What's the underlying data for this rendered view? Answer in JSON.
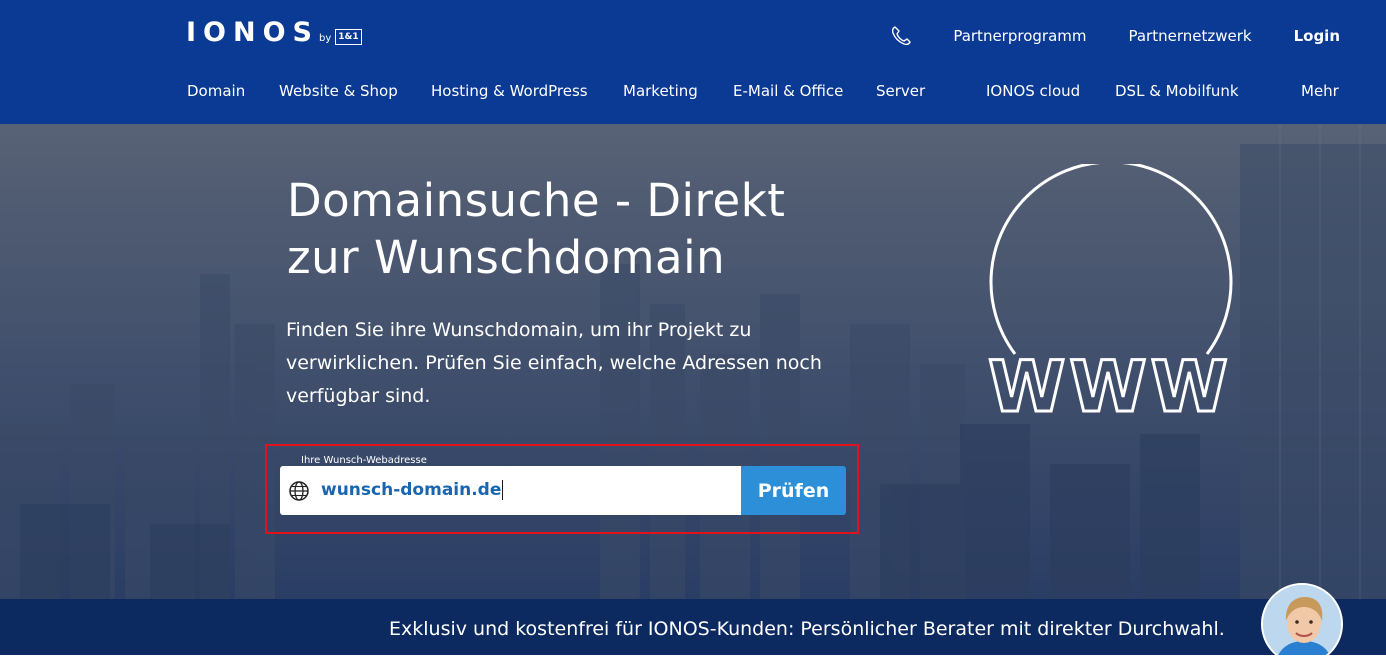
{
  "header": {
    "logo": {
      "wordmark": "IONOS",
      "by": "by",
      "badge": "1&1"
    },
    "top_links": [
      {
        "label": "Partnerprogramm"
      },
      {
        "label": "Partnernetzwerk"
      },
      {
        "label": "Login"
      }
    ],
    "nav": [
      {
        "label": "Domain"
      },
      {
        "label": "Website & Shop"
      },
      {
        "label": "Hosting & WordPress"
      },
      {
        "label": "Marketing"
      },
      {
        "label": "E-Mail & Office"
      },
      {
        "label": "Server"
      },
      {
        "label": "IONOS cloud"
      },
      {
        "label": "DSL & Mobilfunk"
      },
      {
        "label": "Mehr"
      }
    ]
  },
  "hero": {
    "title_line1": "Domainsuche - Direkt",
    "title_line2": "zur Wunschdomain",
    "subtitle": "Finden Sie ihre Wunschdomain, um ihr Projekt zu verwirklichen. Prüfen Sie einfach, welche Adressen noch verfügbar sind.",
    "search": {
      "label": "Ihre Wunsch-Webadresse",
      "value": "wunsch-domain.de",
      "button_label": "Prüfen"
    },
    "graphic_text": "WWW"
  },
  "banner": {
    "text": "Exklusiv und kostenfrei für IONOS-Kunden: Persönlicher Berater mit direkter Durchwahl."
  },
  "colors": {
    "header_bg": "#0b3a94",
    "button_bg": "#2d8fd8",
    "highlight_border": "#e3121a",
    "banner_bg": "#0d2a60",
    "input_text": "#1966b0"
  },
  "icons": [
    "phone-icon",
    "globe-icon",
    "www-globe-icon"
  ]
}
